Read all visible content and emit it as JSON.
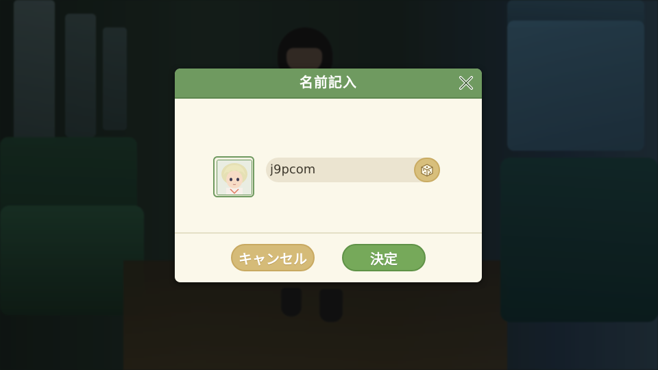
{
  "dialog": {
    "title": "名前記入",
    "close_icon": "close-icon",
    "name_value": "j9pcom",
    "dice_icon": "dice-icon",
    "avatar_icon": "character-portrait",
    "cancel_label": "キャンセル",
    "confirm_label": "決定"
  },
  "colors": {
    "header_green": "#6f9a60",
    "panel_cream": "#fbf8ea",
    "cancel_tan": "#d5bb78",
    "confirm_green": "#76a95a",
    "field_bg": "#ebe4d0"
  }
}
